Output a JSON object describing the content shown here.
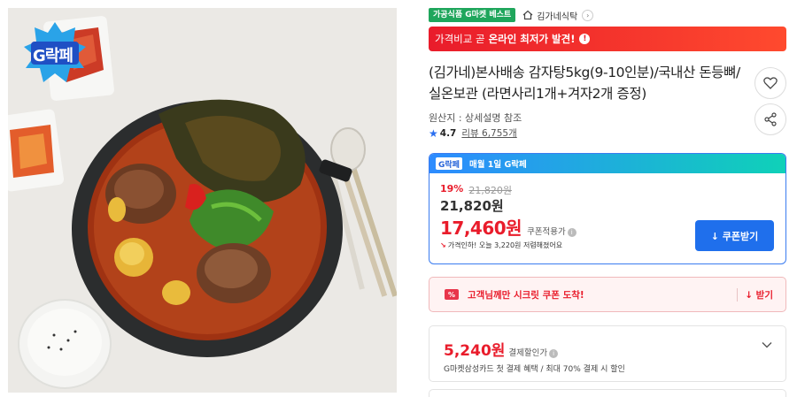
{
  "image": {
    "badge_text": "G락페"
  },
  "top_row": {
    "tag": "가공식품 G마켓 베스트",
    "store_name": "김가네식탁",
    "store_arrow": "›"
  },
  "lowest_bar": {
    "prefix": "가격비교 곧",
    "highlight": "온라인 최저가 발견!",
    "icon": "!"
  },
  "product": {
    "title": "(김가네)본사배송 감자탕5kg(9-10인분)/국내산 돈등뼈/실온보관 (라면사리1개+겨자2개 증정)",
    "origin": "원산지 : 상세설명 참조",
    "star": "★",
    "rating": "4.7",
    "review_label": "리뷰 6,755개"
  },
  "price_box": {
    "header_badge": "G락페",
    "header_text": "매월 1일 G락페",
    "discount_pct": "19%",
    "original_price": "21,820원",
    "mid_price": "21,820원",
    "final_price": "17,460원",
    "coupon_applied": "쿠폰적용가",
    "info": "i",
    "saving_arrow": "↘",
    "saving_note": "가격인하! 오늘 3,220원 저렴해졌어요",
    "coupon_button": "↓ 쿠폰받기"
  },
  "secret": {
    "icon": "%",
    "text": "고객님께만 시크릿 쿠폰 도착!",
    "get": "↓ 받기"
  },
  "card_discount": {
    "amount": "5,240원",
    "label": "결제할인가",
    "info": "i",
    "desc": "G마켓삼성카드 첫 결제 혜택 / 최대 70% 결제 시 할인"
  },
  "colors": {
    "accent_red": "#e91c2b",
    "accent_blue": "#1f6fec",
    "green_tag": "#1fa65c"
  }
}
